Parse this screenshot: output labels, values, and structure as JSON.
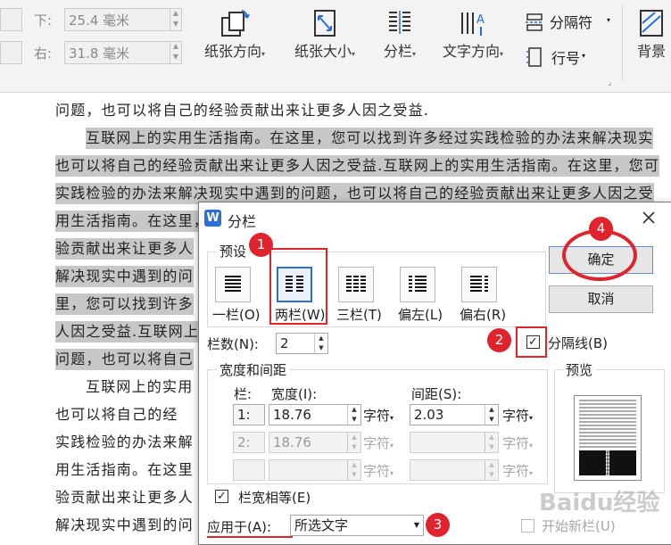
{
  "ribbon": {
    "margin_bottom_label": "下:",
    "margin_bottom_value": "25.4 毫米",
    "margin_right_label": "右:",
    "margin_right_value": "31.8 毫米",
    "orientation_label": "纸张方向",
    "size_label": "纸张大小",
    "columns_label": "分栏",
    "text_direction_label": "文字方向",
    "separator_label": "分隔符",
    "line_number_label": "行号",
    "background_label": "背景"
  },
  "document": {
    "lines": [
      "问题，也可以将自己的经验贡献出来让更多人因之受益.",
      "互联网上的实用生活指南。在这里，您可以找到许多经过实践检验的办法来解决现实",
      "也可以将自己的经验贡献出来让更多人因之受益.互联网上的实用生活指南。在这里，您可",
      "实践检验的办法来解决现实中遇到的问题，也可以将自己的经验贡献出来让更多人因之受",
      "用生活指南。在这里，",
      "验贡献出来让更多人",
      "解决现实中遇到的问",
      "里，您可以找到许多",
      "人因之受益.互联网上",
      "问题，也可以将自己",
      "互联网上的实用",
      "也可以将自己的经",
      "实践检验的办法来解",
      "用生活指南。在这里",
      "验贡献出来让更多人",
      "解决现实中遇到的问"
    ]
  },
  "dialog": {
    "title": "分栏",
    "presets_label": "预设",
    "presets": [
      {
        "label": "一栏(O)",
        "name": "preset-one-column"
      },
      {
        "label": "两栏(W)",
        "name": "preset-two-columns"
      },
      {
        "label": "三栏(T)",
        "name": "preset-three-columns"
      },
      {
        "label": "偏左(L)",
        "name": "preset-left"
      },
      {
        "label": "偏右(R)",
        "name": "preset-right"
      }
    ],
    "columns_count_label": "栏数(N):",
    "columns_count_value": "2",
    "separator_line_label": "分隔线(B)",
    "width_spacing_label": "宽度和间距",
    "col_header": "栏:",
    "width_header": "宽度(I):",
    "spacing_header": "间距(S):",
    "rows": [
      {
        "index": "1:",
        "width": "18.76",
        "unit": "字符",
        "spacing": "2.03",
        "spacing_unit": "字符"
      },
      {
        "index": "2:",
        "width": "18.76",
        "unit": "字符",
        "spacing": "",
        "spacing_unit": "字符"
      },
      {
        "index": "",
        "width": "",
        "unit": "字符",
        "spacing": "",
        "spacing_unit": "字符"
      }
    ],
    "equal_width_label": "栏宽相等(E)",
    "apply_to_label": "应用于(A):",
    "apply_to_value": "所选文字",
    "new_column_label": "开始新栏(U)",
    "preview_label": "预览",
    "ok_label": "确定",
    "cancel_label": "取消"
  },
  "annotations": [
    "1",
    "2",
    "3",
    "4"
  ],
  "watermark": "Baidu经验",
  "colors": {
    "annotation_red": "#e0242d",
    "selection_gray": "#c7c7c7",
    "wps_blue": "#2b6fd6"
  }
}
